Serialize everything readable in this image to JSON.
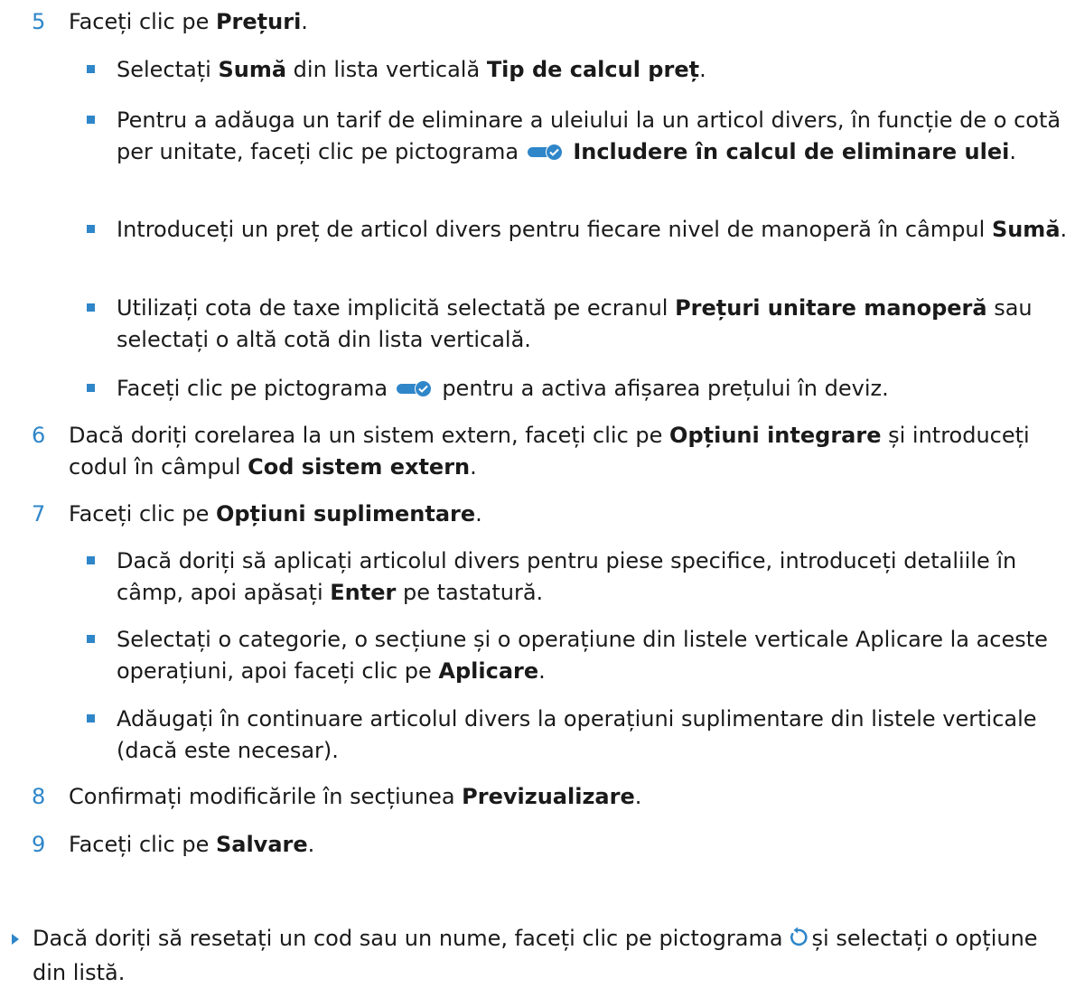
{
  "colors": {
    "accent": "#2f86c9",
    "text": "#1a1a1a"
  },
  "steps": [
    {
      "num": "5",
      "parts": [
        "Faceți clic pe ",
        "Prețuri",
        "."
      ]
    },
    {
      "num": "6",
      "parts": [
        "Dacă doriți corelarea la un sistem extern, faceți clic pe ",
        "Opțiuni integrare",
        " și introduceți codul în câmpul ",
        "Cod sistem extern",
        "."
      ]
    },
    {
      "num": "7",
      "parts": [
        "Faceți clic pe ",
        "Opțiuni suplimentare",
        "."
      ]
    },
    {
      "num": "8",
      "parts": [
        "Confirmați modificările în secțiunea ",
        "Previzualizare",
        "."
      ]
    },
    {
      "num": "9",
      "parts": [
        "Faceți clic pe ",
        "Salvare",
        "."
      ]
    }
  ],
  "step5_bullets": [
    {
      "parts": [
        "Selectați ",
        "Sumă",
        " din lista verticală ",
        "Tip de calcul preț",
        "."
      ]
    },
    {
      "parts": [
        "Pentru a adăuga un tarif de eliminare a uleiului la un articol divers, în funcție de o cotă per unitate, faceți clic pe pictograma",
        "Includere în calcul de eliminare ulei",
        "."
      ],
      "icon": "toggle-on-icon"
    },
    {
      "parts": [
        "Introduceți un preț de articol divers pentru fiecare nivel de manoperă în câmpul ",
        "Sumă",
        "."
      ]
    },
    {
      "parts": [
        "Utilizați cota de taxe implicită selectată pe ecranul ",
        "Prețuri unitare manoperă",
        " sau selectați o altă cotă din lista verticală."
      ]
    },
    {
      "parts": [
        "Faceți clic pe pictograma",
        " pentru a activa afișarea prețului în deviz."
      ],
      "icon": "toggle-on-icon"
    }
  ],
  "step7_bullets": [
    {
      "parts": [
        "Dacă doriți să aplicați articolul divers pentru piese specifice, introduceți detaliile în câmp, apoi apăsați ",
        "Enter",
        " pe tastatură."
      ]
    },
    {
      "parts": [
        "Selectați o categorie, o secțiune și o operațiune din listele verticale Aplicare la aceste operațiuni, apoi faceți clic pe ",
        "Aplicare",
        "."
      ]
    },
    {
      "parts": [
        "Adăugați în continuare articolul divers la operațiuni suplimentare din listele verticale (dacă este necesar)."
      ]
    }
  ],
  "note": {
    "parts": [
      "Dacă doriți să resetați un cod sau un nume, faceți clic pe pictograma",
      "și selectați o opțiune din listă."
    ],
    "icon": "reset-icon"
  }
}
